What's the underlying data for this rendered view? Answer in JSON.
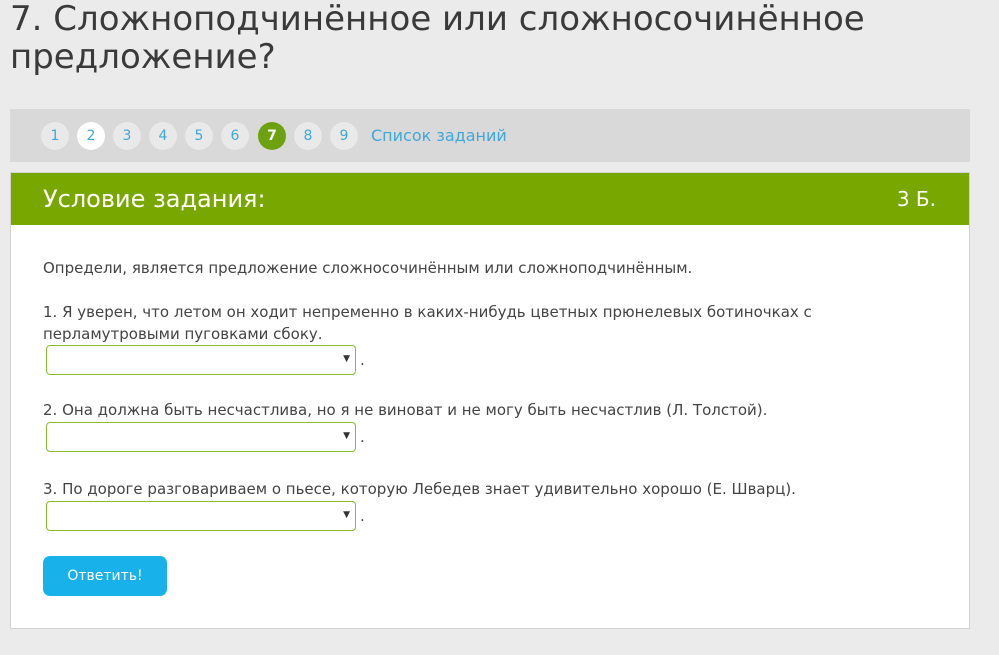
{
  "page": {
    "title": "7. Сложноподчинённое или сложносочинённое предложение?"
  },
  "nav": {
    "items": [
      {
        "label": "1",
        "state": "default"
      },
      {
        "label": "2",
        "state": "done"
      },
      {
        "label": "3",
        "state": "default"
      },
      {
        "label": "4",
        "state": "default"
      },
      {
        "label": "5",
        "state": "default"
      },
      {
        "label": "6",
        "state": "default"
      },
      {
        "label": "7",
        "state": "active"
      },
      {
        "label": "8",
        "state": "default"
      },
      {
        "label": "9",
        "state": "default"
      }
    ],
    "task_list_label": "Список заданий"
  },
  "task": {
    "header_title": "Условие задания:",
    "points": "3 Б.",
    "instruction": "Определи, является предложение сложносочинённым или сложноподчинённым.",
    "questions": [
      {
        "text": "1. Я уверен, что летом он ходит непременно в каких-нибудь цветных прюнелевых ботиночках с перламутровыми пуговками сбоку.",
        "selected": ""
      },
      {
        "text": "2. Она должна быть несчастлива, но я не виноват и не могу быть несчастлив (Л. Толстой).",
        "selected": ""
      },
      {
        "text": "3. По дороге разговариваем о пьесе, которую Лебедев знает удивительно хорошо (Е. Шварц).",
        "selected": ""
      }
    ],
    "terminator": ".",
    "submit_label": "Ответить!"
  },
  "colors": {
    "accent_green": "#78a800",
    "active_pill": "#6ea10f",
    "link_blue": "#3fa7d9",
    "button_blue": "#18b1ea"
  }
}
